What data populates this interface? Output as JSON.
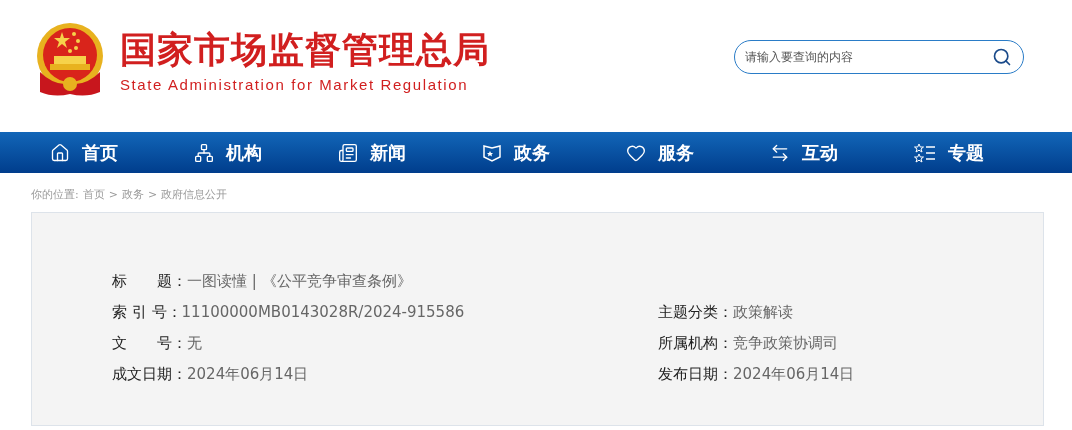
{
  "header": {
    "title": "国家市场监督管理总局",
    "subtitle": "State Administration for Market Regulation",
    "search": {
      "placeholder": "请输入要查询的内容"
    }
  },
  "nav": [
    {
      "label": "首页",
      "kind": "home"
    },
    {
      "label": "机构",
      "kind": "org"
    },
    {
      "label": "新闻",
      "kind": "news"
    },
    {
      "label": "政务",
      "kind": "affairs"
    },
    {
      "label": "服务",
      "kind": "service"
    },
    {
      "label": "互动",
      "kind": "interact"
    },
    {
      "label": "专题",
      "kind": "topic"
    }
  ],
  "breadcrumb": {
    "prefix": "你的位置:",
    "items": [
      "首页",
      "政务",
      "政府信息公开"
    ],
    "separator": ">"
  },
  "info": [
    {
      "left": {
        "label": "标　　题：",
        "value": "一图读懂 | 《公平竞争审查条例》"
      }
    },
    {
      "left": {
        "label": "索 引 号：",
        "value": "11100000MB0143028R/2024-915586"
      },
      "right": {
        "label": "主题分类：",
        "value": "政策解读"
      }
    },
    {
      "left": {
        "label": "文　　号：",
        "value": "无"
      },
      "right": {
        "label": "所属机构：",
        "value": "竞争政策协调司"
      }
    },
    {
      "left": {
        "label": "成文日期：",
        "value": "2024年06月14日"
      },
      "right": {
        "label": "发布日期：",
        "value": "2024年06月14日"
      }
    }
  ]
}
